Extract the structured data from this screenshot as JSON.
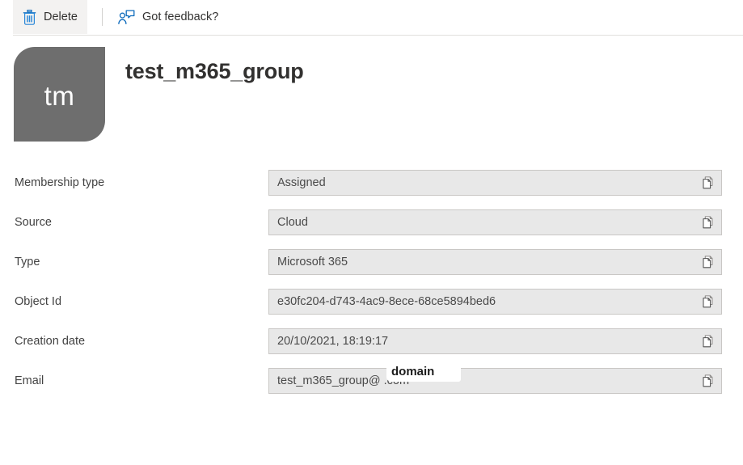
{
  "commandbar": {
    "delete": {
      "label": "Delete",
      "icon": "trash-icon"
    },
    "feedback": {
      "label": "Got feedback?",
      "icon": "feedback-person-icon"
    }
  },
  "header": {
    "avatar_initials": "tm",
    "avatar_color": "#6e6e6e",
    "title": "test_m365_group"
  },
  "properties": [
    {
      "label": "Membership type",
      "value": "Assigned",
      "copy_icon": "copy-icon"
    },
    {
      "label": "Source",
      "value": "Cloud",
      "copy_icon": "copy-icon"
    },
    {
      "label": "Type",
      "value": "Microsoft 365",
      "copy_icon": "copy-icon"
    },
    {
      "label": "Object Id",
      "value": "e30fc204-d743-4ac9-8ece-68ce5894bed6",
      "copy_icon": "copy-icon"
    },
    {
      "label": "Creation date",
      "value": "20/10/2021, 18:19:17",
      "copy_icon": "copy-icon"
    },
    {
      "label": "Email",
      "value": "test_m365_group@            .com",
      "copy_icon": "copy-icon"
    }
  ],
  "email_redaction": {
    "text": "domain"
  },
  "colors": {
    "accent_blue": "#0078d4",
    "field_background": "#e8e8e8",
    "field_border": "#c9c7c5",
    "text_primary": "#323130",
    "text_value": "#4a4a4a",
    "hover_background": "#f3f2f1"
  }
}
